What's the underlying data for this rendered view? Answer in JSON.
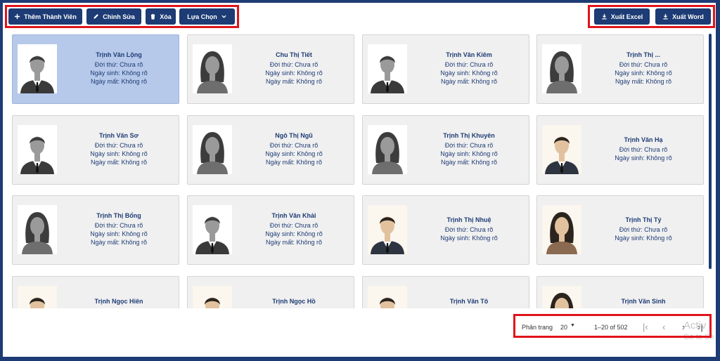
{
  "toolbar": {
    "add_label": "Thêm Thành Viên",
    "edit_label": "Chỉnh Sửa",
    "delete_label": "Xóa",
    "options_label": "Lựa Chọn",
    "export_excel_label": "Xuất Excel",
    "export_word_label": "Xuất Word"
  },
  "members": [
    {
      "name": "Trịnh Văn Lộng",
      "rival": "Đời thứ: Chưa rõ",
      "birth": "Ngày sinh: Không rõ",
      "death": "Ngày mất: Không rõ",
      "gender": "male",
      "photo_style": "gray",
      "selected": true
    },
    {
      "name": "Chu Thị Tiết",
      "rival": "Đời thứ: Chưa rõ",
      "birth": "Ngày sinh: Không rõ",
      "death": "Ngày mất: Không rõ",
      "gender": "female",
      "photo_style": "gray",
      "selected": false
    },
    {
      "name": "Trịnh Văn Kiêm",
      "rival": "Đời thứ: Chưa rõ",
      "birth": "Ngày sinh: Không rõ",
      "death": "Ngày mất: Không rõ",
      "gender": "male",
      "photo_style": "gray",
      "selected": false
    },
    {
      "name": "Trịnh Thị ...",
      "rival": "Đời thứ: Chưa rõ",
      "birth": "Ngày sinh: Không rõ",
      "death": "Ngày mất: Không rõ",
      "gender": "female",
      "photo_style": "gray",
      "selected": false
    },
    {
      "name": "Trịnh Văn Sơ",
      "rival": "Đời thứ: Chưa rõ",
      "birth": "Ngày sinh: Không rõ",
      "death": "Ngày mất: Không rõ",
      "gender": "male",
      "photo_style": "gray",
      "selected": false
    },
    {
      "name": "Ngô Thị Ngũ",
      "rival": "Đời thứ: Chưa rõ",
      "birth": "Ngày sinh: Không rõ",
      "death": "Ngày mất: Không rõ",
      "gender": "female",
      "photo_style": "gray",
      "selected": false
    },
    {
      "name": "Trịnh Thị Khuyên",
      "rival": "Đời thứ: Chưa rõ",
      "birth": "Ngày sinh: Không rõ",
      "death": "Ngày mất: Không rõ",
      "gender": "female",
      "photo_style": "gray",
      "selected": false
    },
    {
      "name": "Trịnh Văn Hạ",
      "rival": "Đời thứ: Chưa rõ",
      "birth": "Ngày sinh: Không rõ",
      "death": "",
      "gender": "male",
      "photo_style": "color",
      "selected": false
    },
    {
      "name": "Trịnh Thị Bổng",
      "rival": "Đời thứ: Chưa rõ",
      "birth": "Ngày sinh: Không rõ",
      "death": "Ngày mất: Không rõ",
      "gender": "female",
      "photo_style": "gray",
      "selected": false
    },
    {
      "name": "Trịnh Văn Khải",
      "rival": "Đời thứ: Chưa rõ",
      "birth": "Ngày sinh: Không rõ",
      "death": "Ngày mất: Không rõ",
      "gender": "male",
      "photo_style": "gray",
      "selected": false
    },
    {
      "name": "Trịnh Thị Nhuệ",
      "rival": "Đời thứ: Chưa rõ",
      "birth": "Ngày sinh: Không rõ",
      "death": "",
      "gender": "male",
      "photo_style": "color",
      "selected": false
    },
    {
      "name": "Trịnh Thị Tý",
      "rival": "Đời thứ: Chưa rõ",
      "birth": "Ngày sinh: Không rõ",
      "death": "",
      "gender": "female",
      "photo_style": "color",
      "selected": false
    },
    {
      "name": "Trịnh Ngọc Hiên",
      "rival": "",
      "birth": "",
      "death": "",
      "gender": "male",
      "photo_style": "color",
      "selected": false
    },
    {
      "name": "Trịnh Ngọc Hồ",
      "rival": "",
      "birth": "",
      "death": "",
      "gender": "male",
      "photo_style": "color",
      "selected": false
    },
    {
      "name": "Trịnh Văn Tô",
      "rival": "",
      "birth": "",
      "death": "",
      "gender": "male",
      "photo_style": "color",
      "selected": false
    },
    {
      "name": "Trịnh Văn Sinh",
      "rival": "",
      "birth": "",
      "death": "",
      "gender": "female",
      "photo_style": "color",
      "selected": false
    }
  ],
  "pagination": {
    "label": "Phân trang",
    "page_size": "20",
    "range": "1–20 of 502"
  },
  "watermark": {
    "line1": "Activ",
    "line2": "Go to Se"
  },
  "colors": {
    "primary": "#1d3b74",
    "selected_card": "#b6c9ea",
    "card": "#f0f0f0",
    "highlight_box": "#e0141b"
  }
}
